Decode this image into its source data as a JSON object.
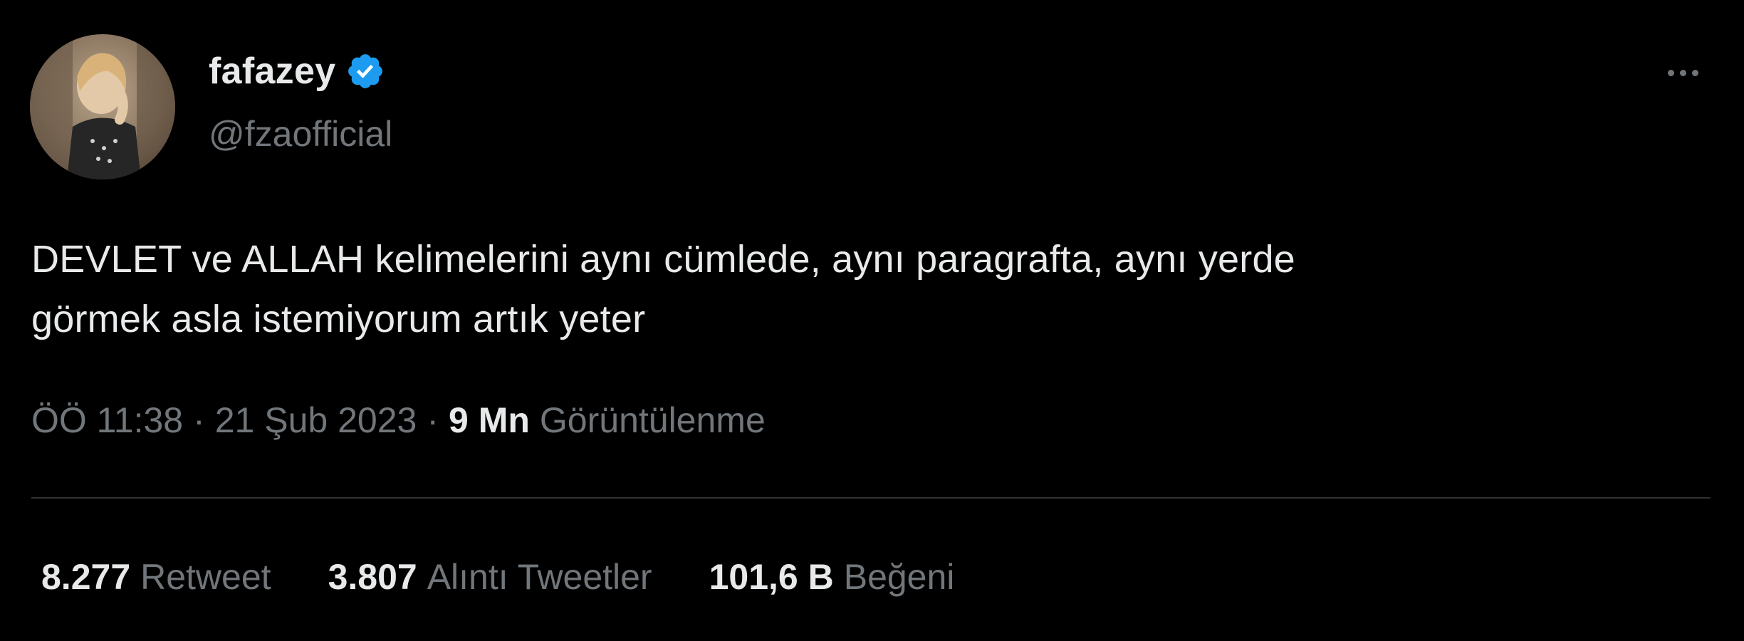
{
  "tweet": {
    "display_name": "fafazey",
    "handle": "@fzaofficial",
    "verified_icon": "verified-badge",
    "more_icon": "more-horizontal-icon",
    "text": "DEVLET ve ALLAH kelimelerini aynı cümlede, aynı paragrafta, aynı yerde\ngörmek asla istemiyorum artık yeter",
    "time": "ÖÖ 11:38",
    "date": "21 Şub 2023",
    "separator": "·",
    "views_count": "9 Mn",
    "views_label": "Görüntülenme",
    "stats": [
      {
        "count": "8.277",
        "label": "Retweet"
      },
      {
        "count": "3.807",
        "label": "Alıntı Tweetler"
      },
      {
        "count": "101,6 B",
        "label": "Beğeni"
      }
    ]
  },
  "colors": {
    "background": "#000000",
    "primary_text": "#e7e9ea",
    "secondary_text": "#71767b",
    "divider": "#2f3336",
    "verified": "#1d9bf0"
  }
}
